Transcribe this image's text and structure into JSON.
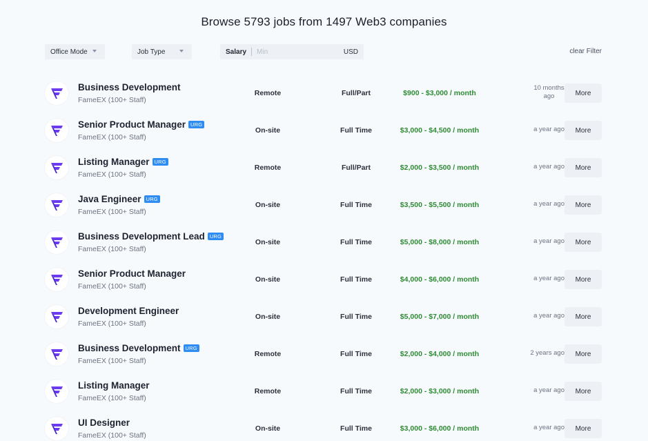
{
  "header": {
    "title": "Browse 5793 jobs from 1497 Web3 companies"
  },
  "filters": {
    "office_mode": "Office Mode",
    "job_type": "Job Type",
    "salary_label": "Salary",
    "salary_min_placeholder": "Min",
    "salary_currency": "USD",
    "clear": "clear Filter"
  },
  "colors": {
    "salary_green": "#2e8b34",
    "urg_blue": "#2f8cf3",
    "logo_purple": "#6c3bf0",
    "button_bg": "#edf1f6"
  },
  "jobs": [
    {
      "title": "Business Development",
      "urg": "",
      "company": "FameEX (100+ Staff)",
      "mode": "Remote",
      "type": "Full/Part",
      "salary": "$900 - $3,000 / month",
      "time": "10 months ago",
      "more": "More"
    },
    {
      "title": "Senior Product Manager",
      "urg": "URG",
      "company": "FameEX (100+ Staff)",
      "mode": "On-site",
      "type": "Full Time",
      "salary": "$3,000 - $4,500 / month",
      "time": "a year ago",
      "more": "More"
    },
    {
      "title": "Listing Manager",
      "urg": "URG",
      "company": "FameEX (100+ Staff)",
      "mode": "Remote",
      "type": "Full/Part",
      "salary": "$2,000 - $3,500 / month",
      "time": "a year ago",
      "more": "More"
    },
    {
      "title": "Java Engineer",
      "urg": "URG",
      "company": "FameEX (100+ Staff)",
      "mode": "On-site",
      "type": "Full Time",
      "salary": "$3,500 - $5,500 / month",
      "time": "a year ago",
      "more": "More"
    },
    {
      "title": "Business Development Lead",
      "urg": "URG",
      "company": "FameEX (100+ Staff)",
      "mode": "On-site",
      "type": "Full Time",
      "salary": "$5,000 - $8,000 / month",
      "time": "a year ago",
      "more": "More"
    },
    {
      "title": "Senior Product Manager",
      "urg": "",
      "company": "FameEX (100+ Staff)",
      "mode": "On-site",
      "type": "Full Time",
      "salary": "$4,000 - $6,000 / month",
      "time": "a year ago",
      "more": "More"
    },
    {
      "title": "Development Engineer",
      "urg": "",
      "company": "FameEX (100+ Staff)",
      "mode": "On-site",
      "type": "Full Time",
      "salary": "$5,000 - $7,000 / month",
      "time": "a year ago",
      "more": "More"
    },
    {
      "title": "Business Development",
      "urg": "URG",
      "company": "FameEX (100+ Staff)",
      "mode": "Remote",
      "type": "Full Time",
      "salary": "$2,000 - $4,000 / month",
      "time": "2 years ago",
      "more": "More"
    },
    {
      "title": "Listing Manager",
      "urg": "",
      "company": "FameEX (100+ Staff)",
      "mode": "Remote",
      "type": "Full Time",
      "salary": "$2,000 - $3,000 / month",
      "time": "a year ago",
      "more": "More"
    },
    {
      "title": "UI Designer",
      "urg": "",
      "company": "FameEX (100+ Staff)",
      "mode": "On-site",
      "type": "Full Time",
      "salary": "$3,000 - $6,000 / month",
      "time": "a year ago",
      "more": "More"
    }
  ]
}
